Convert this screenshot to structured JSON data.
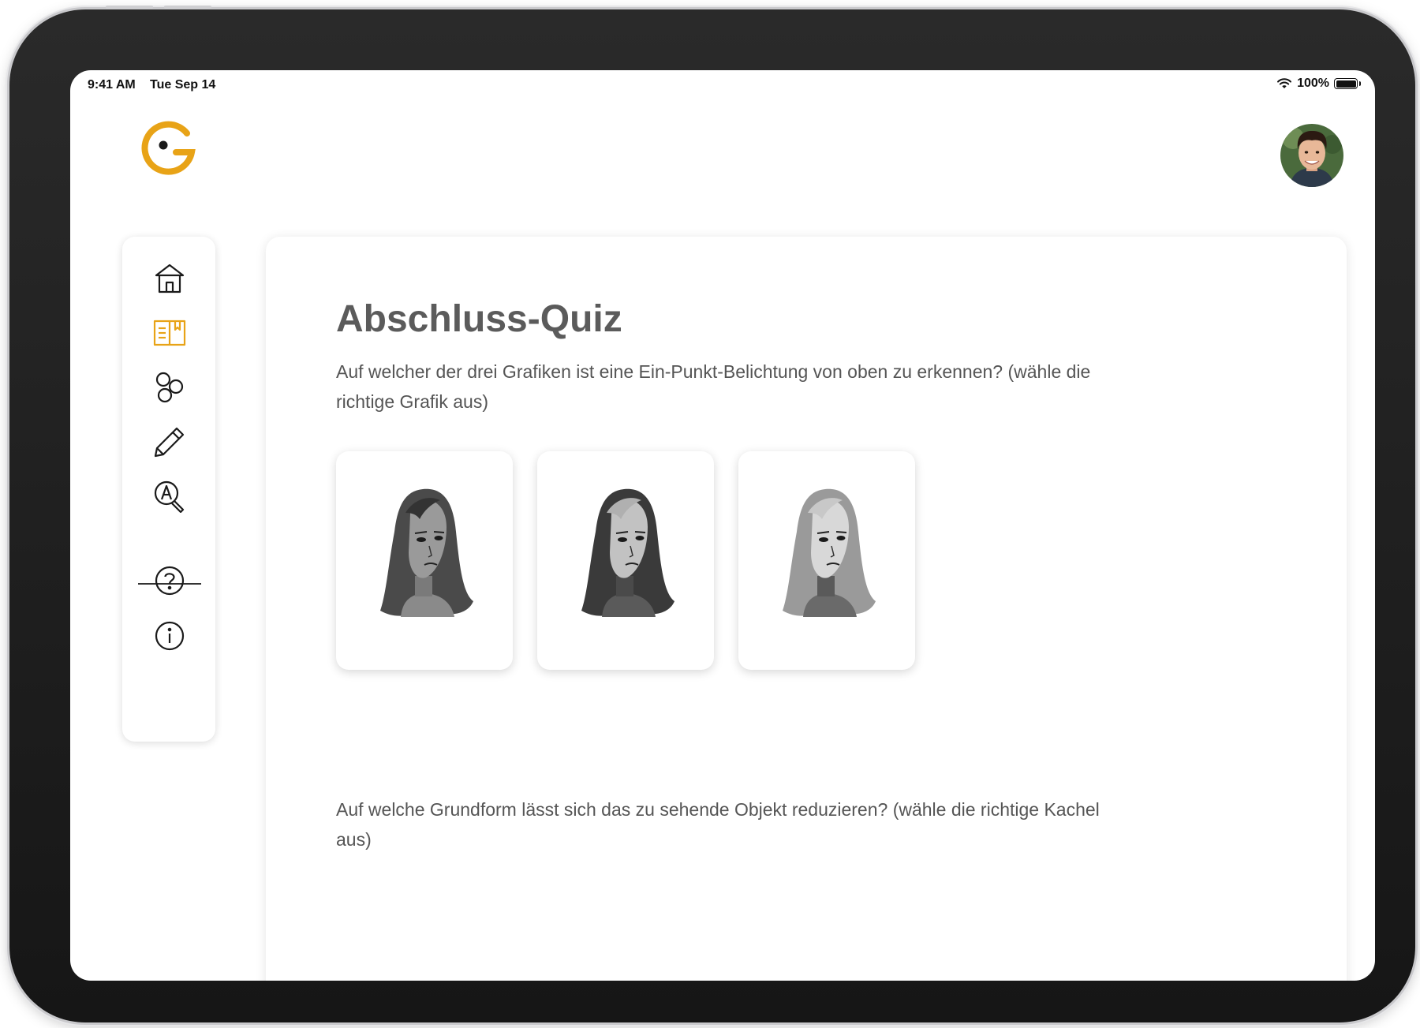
{
  "status_bar": {
    "time": "9:41 AM",
    "date": "Tue Sep 14",
    "battery": "100%"
  },
  "logo": {
    "icon": "g-logo-icon",
    "color": "#E8A317"
  },
  "user": {
    "avatar": "user-avatar"
  },
  "sidebar": {
    "active_index": 1,
    "accent": "#E8A317",
    "items": [
      {
        "icon": "home-icon"
      },
      {
        "icon": "book-icon"
      },
      {
        "icon": "circles-icon"
      },
      {
        "icon": "pencil-icon"
      },
      {
        "icon": "letter-search-icon"
      }
    ],
    "bottom_items": [
      {
        "icon": "help-icon"
      },
      {
        "icon": "info-icon"
      }
    ]
  },
  "quiz": {
    "title": "Abschluss-Quiz",
    "question1": "Auf welcher der drei Grafiken ist eine Ein-Punkt-Belichtung von oben zu erkennen? (wähle die richtige Grafik aus)",
    "question2": "Auf welche Grundform lässt sich das zu sehende Objekt reduzieren? (wähle die richtige Kachel aus)",
    "options": [
      {
        "image": "portrait-drawing-1"
      },
      {
        "image": "portrait-drawing-2"
      },
      {
        "image": "portrait-drawing-3"
      }
    ]
  }
}
